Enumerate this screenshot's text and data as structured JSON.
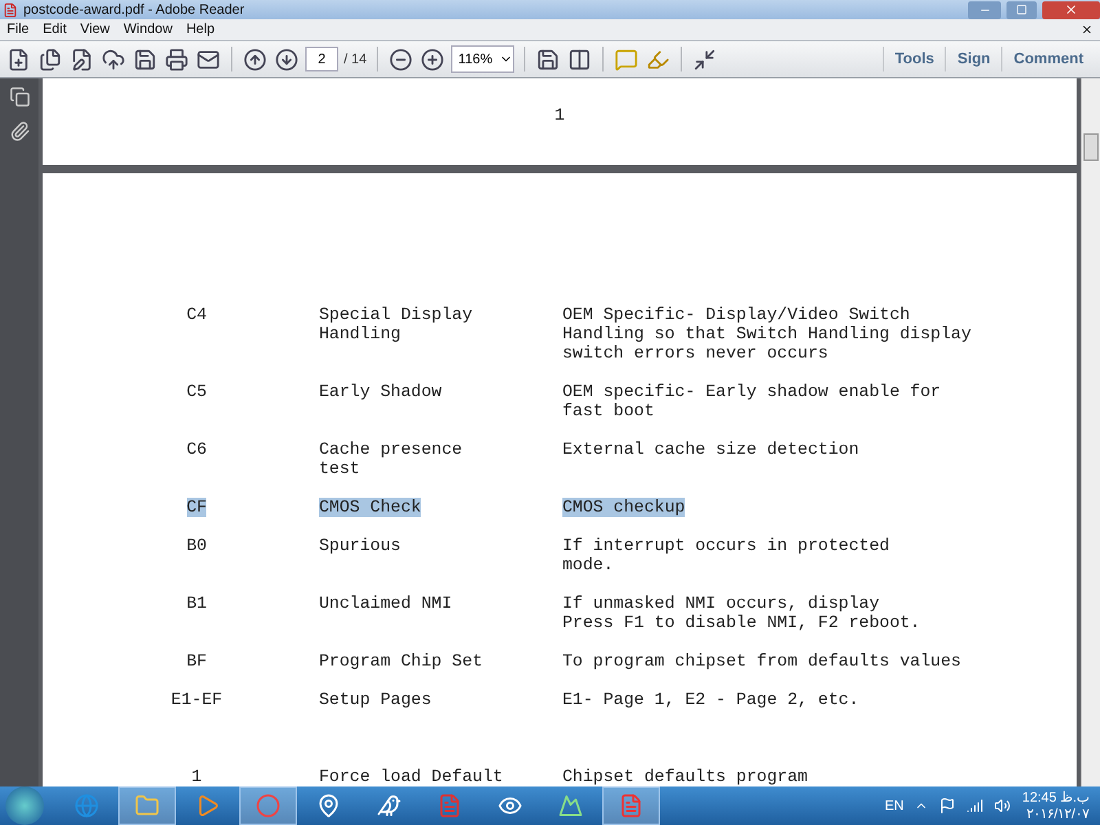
{
  "window": {
    "title": "postcode-award.pdf - Adobe Reader"
  },
  "menu": [
    "File",
    "Edit",
    "View",
    "Window",
    "Help"
  ],
  "toolbar": {
    "page": "2",
    "page_total": "/ 14",
    "zoom": "116%",
    "panes": [
      "Tools",
      "Sign",
      "Comment"
    ]
  },
  "previous_page": {
    "page_number": "1"
  },
  "rows": [
    {
      "code": "C4",
      "name": "Special Display\nHandling",
      "description": "OEM Specific- Display/Video Switch\nHandling so that Switch Handling display\nswitch errors never occurs",
      "selected": false,
      "kind": "row"
    },
    {
      "code": "C5",
      "name": "Early Shadow",
      "description": "OEM specific- Early shadow enable for\nfast boot",
      "selected": false,
      "kind": "row"
    },
    {
      "code": "C6",
      "name": "Cache presence\ntest",
      "description": "External cache size detection",
      "selected": false,
      "kind": "row"
    },
    {
      "code": "CF",
      "name": "CMOS Check",
      "description": "CMOS checkup",
      "selected": true,
      "kind": "row"
    },
    {
      "code": "B0",
      "name": "Spurious",
      "description": "If interrupt occurs in protected\nmode.",
      "selected": false,
      "kind": "row"
    },
    {
      "code": "B1",
      "name": "Unclaimed NMI",
      "description": "If unmasked NMI occurs, display\nPress F1 to disable NMI, F2 reboot.",
      "selected": false,
      "kind": "row"
    },
    {
      "code": "BF",
      "name": "Program Chip Set",
      "description": "To program chipset from defaults values",
      "selected": false,
      "kind": "row"
    },
    {
      "code": "E1-EF",
      "name": "Setup Pages",
      "description": "E1- Page 1, E2 - Page 2, etc.",
      "selected": false,
      "kind": "row"
    },
    {
      "code": "1",
      "name": "Force load Default",
      "description": "Chipset defaults program",
      "selected": false,
      "kind": "section_start"
    }
  ],
  "taskbar": {
    "apps": [
      {
        "selected": false
      },
      {
        "selected": true
      },
      {
        "selected": false
      },
      {
        "selected": true
      },
      {
        "selected": false
      },
      {
        "selected": false
      },
      {
        "selected": false
      },
      {
        "selected": false
      },
      {
        "selected": false
      },
      {
        "selected": true
      }
    ],
    "language": "EN",
    "time": "12:45 ب.ظ",
    "date": "۲۰۱۶/۱۲/۰۷"
  }
}
